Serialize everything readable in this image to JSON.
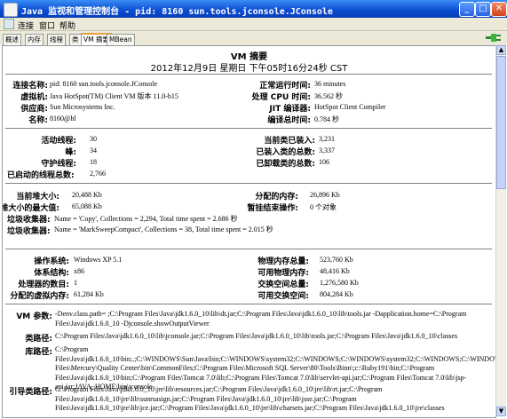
{
  "window": {
    "title": "Java 监视和管理控制台 - pid: 8160 sun.tools.jconsole.JConsole"
  },
  "menu": [
    "连接",
    "窗口",
    "帮助"
  ],
  "tabs": [
    "概述",
    "内存",
    "线程",
    "类",
    "VM 摘要",
    "MBean"
  ],
  "active_tab": "VM 摘要",
  "summary": {
    "title": "VM 摘要",
    "date": "2012年12月9日 星期日 下午05时16分24秒 CST"
  },
  "section1": {
    "connection_name": {
      "label": "连接名称:",
      "value": "pid: 8160 sun.tools.jconsole.JConsole"
    },
    "vm": {
      "label": "虚拟机:",
      "value": "Java HotSpot(TM) Client VM 版本 11.0-b15"
    },
    "vendor": {
      "label": "供应商:",
      "value": "Sun Microsystems Inc."
    },
    "name": {
      "label": "名称:",
      "value": "8160@hl"
    },
    "uptime": {
      "label": "正常运行时间:",
      "value": "36 minutes"
    },
    "process_cpu": {
      "label": "处理 CPU 时间:",
      "value": "36.562 秒"
    },
    "jit": {
      "label": "JIT 编译器:",
      "value": "HotSpot Client Compiler"
    },
    "compile_time": {
      "label": "编译总时间:",
      "value": "0.784 秒"
    }
  },
  "section2": {
    "live_threads": {
      "label": "活动线程:",
      "value": "30"
    },
    "peak": {
      "label": "峰:",
      "value": "34"
    },
    "daemon": {
      "label": "守护线程:",
      "value": "18"
    },
    "total_started": {
      "label": "已启动的线程总数:",
      "value": "2,766"
    },
    "loaded_classes": {
      "label": "当前类已装入:",
      "value": "3,231"
    },
    "total_loaded": {
      "label": "已装入类的总数:",
      "value": "3,337"
    },
    "unloaded": {
      "label": "已卸载类的总数:",
      "value": "106"
    }
  },
  "section3": {
    "heap_size": {
      "label": "当前堆大小:",
      "value": "20,488 Kb"
    },
    "max_heap": {
      "label": "堆大小的最大值:",
      "value": "65,088 Kb"
    },
    "committed": {
      "label": "分配的内存:",
      "value": "26,896 Kb"
    },
    "pending": {
      "label": "暂挂结束操作:",
      "value": "0 个对象"
    },
    "gc1": {
      "label": "垃圾收集器:",
      "value": "Name = 'Copy', Collections = 2,294, Total time spent = 2.686 秒"
    },
    "gc2": {
      "label": "垃圾收集器:",
      "value": "Name = 'MarkSweepCompact', Collections = 38, Total time spent = 2.015 秒"
    }
  },
  "section4": {
    "os": {
      "label": "操作系统:",
      "value": "Windows XP 5.1"
    },
    "arch": {
      "label": "体系结构:",
      "value": "x86"
    },
    "processors": {
      "label": "处理器的数目:",
      "value": "1"
    },
    "committed_vm": {
      "label": "分配的虚拟内存:",
      "value": "61,284 Kb"
    },
    "total_phys": {
      "label": "物理内存总量:",
      "value": "523,760 Kb"
    },
    "free_phys": {
      "label": "可用物理内存:",
      "value": "48,416 Kb"
    },
    "total_swap": {
      "label": "交换空间总量:",
      "value": "1,276,580 Kb"
    },
    "free_swap": {
      "label": "可用交换空间:",
      "value": "804,284 Kb"
    }
  },
  "section5": {
    "vm_args": {
      "label": "VM 参数:",
      "value": "-Denv.class.path= ;C:\\Program Files\\Java\\jdk1.6.0_10\\lib\\dt.jar;C:\\Program Files\\Java\\jdk1.6.0_10\\lib\\tools.jar -Dapplication.home=C:\\Program Files\\Java\\jdk1.6.0_10 -Djconsole.showOutputViewer"
    },
    "class_path": {
      "label": "类路径:",
      "value": "C:\\Program Files\\Java\\jdk1.6.0_10\\lib\\jconsole.jar;C:\\Program Files\\Java\\jdk1.6.0_10\\lib\\tools.jar;C:\\Program Files\\Java\\jdk1.6.0_10\\classes"
    },
    "library_path": {
      "label": "库路径:",
      "value": "C:\\Program Files\\Java\\jdk1.6.0_10\\bin;.;C:\\WINDOWS\\Sun\\Java\\bin;C:\\WINDOWS\\system32;C:\\WINDOWS;C:\\WINDOWS\\system32;C:\\WINDOWS;C:\\WINDOWS\\System32\\Wbem;C:\\Program Files\\Mercury\\Quality Center\\bin\\CommonFiles;C:\\Program Files\\Microsoft SQL Server\\80\\Tools\\Binn\\;c:\\Ruby191\\bin;C:\\Program Files\\Java\\jdk1.6.0_10\\bin;C:\\Program Files\\Tomcat 7.0\\lib;C:\\Program Files\\Tomcat 7.0\\lib\\servlet-api.jar;C:\\Program Files\\Tomcat 7.0\\lib\\jsp-api.jar;JAVA_HOME\\bin\\jconsole"
    },
    "boot_class_path": {
      "label": "引导类路径:",
      "value": "C:\\Program Files\\Java\\jdk1.6.0_10\\jre\\lib\\resources.jar;C:\\Program Files\\Java\\jdk1.6.0_10\\jre\\lib\\rt.jar;C:\\Program Files\\Java\\jdk1.6.0_10\\jre\\lib\\sunrsasign.jar;C:\\Program Files\\Java\\jdk1.6.0_10\\jre\\lib\\jsse.jar;C:\\Program Files\\Java\\jdk1.6.0_10\\jre\\lib\\jce.jar;C:\\Program Files\\Java\\jdk1.6.0_10\\jre\\lib\\charsets.jar;C:\\Program Files\\Java\\jdk1.6.0_10\\jre\\classes"
    }
  }
}
